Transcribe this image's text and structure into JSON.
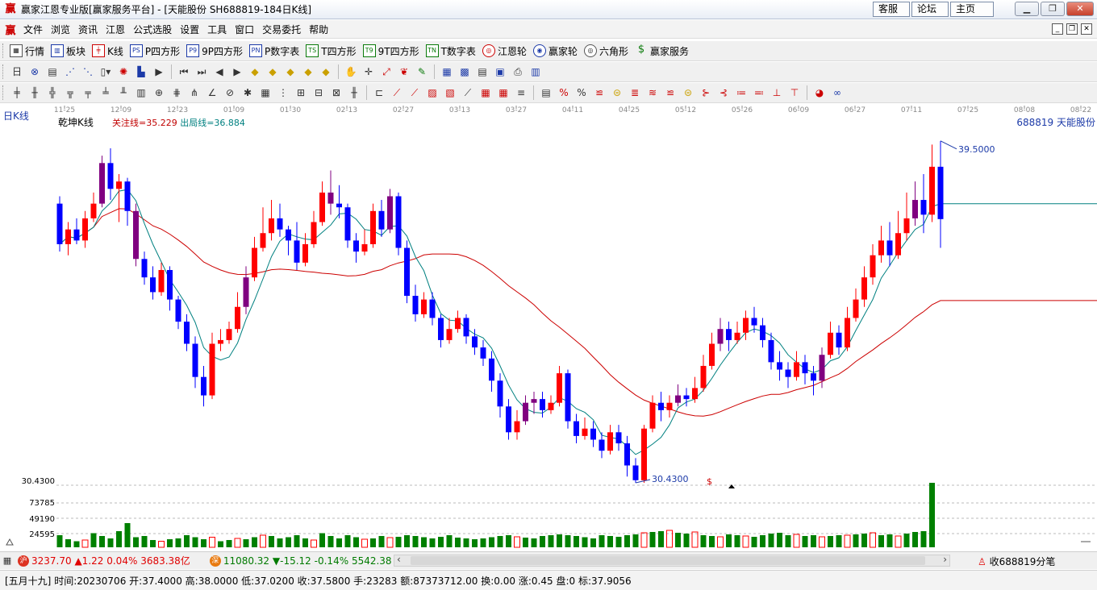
{
  "window": {
    "title": "赢家江恩专业版[赢家服务平台] - [天能股份  SH688819-184日K线]",
    "logo": "赢",
    "links": [
      "客服",
      "论坛",
      "主页"
    ]
  },
  "menu": [
    "文件",
    "浏览",
    "资讯",
    "江恩",
    "公式选股",
    "设置",
    "工具",
    "窗口",
    "交易委托",
    "帮助"
  ],
  "toolbar1": [
    {
      "icon": "grid-icon",
      "glyph": "▦",
      "label": "行情"
    },
    {
      "icon": "blocks-icon",
      "glyph": "▥",
      "label": "板块"
    },
    {
      "icon": "candle-icon",
      "glyph": "╪",
      "label": "K线"
    },
    {
      "icon": "ps-icon",
      "glyph": "PS",
      "label": "P四方形"
    },
    {
      "icon": "p9-icon",
      "glyph": "P9",
      "label": "9P四方形"
    },
    {
      "icon": "pn-icon",
      "glyph": "PN",
      "label": "P数字表"
    },
    {
      "icon": "ts-icon",
      "glyph": "TS",
      "label": "T四方形"
    },
    {
      "icon": "t9-icon",
      "glyph": "T9",
      "label": "9T四方形"
    },
    {
      "icon": "tn-icon",
      "glyph": "TN",
      "label": "T数字表"
    },
    {
      "icon": "gann-wheel-icon",
      "glyph": "◎",
      "label": "江恩轮"
    },
    {
      "icon": "winner-wheel-icon",
      "glyph": "◉",
      "label": "赢家轮"
    },
    {
      "icon": "hexagon-icon",
      "glyph": "◎",
      "label": "六角形"
    },
    {
      "icon": "dollar-icon",
      "glyph": "$",
      "label": "赢家服务"
    }
  ],
  "chart": {
    "period_label": "日K线",
    "indicator_name": "乾坤K线",
    "watch_line": "关注线=35.229",
    "exit_line": "出局线=36.884",
    "symbol_label": "688819  天能股份",
    "high_marker": "39.5000",
    "low_marker": "30.4300",
    "low_axis_label": "30.4300",
    "vol_levels": [
      "73785",
      "49190",
      "24595"
    ],
    "dollar_mark": "$",
    "date_ticks": [
      "11-25",
      "12-09",
      "12-23",
      "01-09",
      "01-30",
      "02-13",
      "02-27",
      "03-13",
      "03-27",
      "04-11",
      "04-25",
      "05-12",
      "05-26",
      "06-09",
      "06-27",
      "07-11",
      "07-25",
      "08-08",
      "08-22"
    ],
    "colors": {
      "up": "#ff0000",
      "down": "#0000ff",
      "neutral": "#800080",
      "slow_line": "#cc0000",
      "fast_line": "#008080",
      "volume": "#008000"
    }
  },
  "chart_data": {
    "type": "candlestick",
    "series": [
      {
        "name": "price",
        "values": [
          [
            38.0,
            36.9,
            38.2,
            36.7
          ],
          [
            36.9,
            37.3,
            37.5,
            36.6
          ],
          [
            37.3,
            37.0,
            37.6,
            36.9
          ],
          [
            37.0,
            37.6,
            37.8,
            36.8
          ],
          [
            37.6,
            38.0,
            38.3,
            37.5
          ],
          [
            38.0,
            39.1,
            39.3,
            37.9
          ],
          [
            39.1,
            38.4,
            39.5,
            38.1
          ],
          [
            38.4,
            38.6,
            38.8,
            37.5
          ],
          [
            38.6,
            37.8,
            38.7,
            37.4
          ],
          [
            37.8,
            36.5,
            38.0,
            36.3
          ],
          [
            36.5,
            36.0,
            36.7,
            35.8
          ],
          [
            36.0,
            35.6,
            36.3,
            35.4
          ],
          [
            35.6,
            36.2,
            36.4,
            35.5
          ],
          [
            36.2,
            35.4,
            36.3,
            35.1
          ],
          [
            35.4,
            34.8,
            35.5,
            34.6
          ],
          [
            34.8,
            34.2,
            35.0,
            34.0
          ],
          [
            34.2,
            33.3,
            34.4,
            33.0
          ],
          [
            33.3,
            32.8,
            33.6,
            32.5
          ],
          [
            32.8,
            34.2,
            34.5,
            32.7
          ],
          [
            34.2,
            34.3,
            34.6,
            34.0
          ],
          [
            34.3,
            34.6,
            34.8,
            34.2
          ],
          [
            34.6,
            35.2,
            35.6,
            34.5
          ],
          [
            35.2,
            36.0,
            36.3,
            35.0
          ],
          [
            36.0,
            36.8,
            37.1,
            35.9
          ],
          [
            36.8,
            37.2,
            37.9,
            36.7
          ],
          [
            37.2,
            37.6,
            38.1,
            37.0
          ],
          [
            37.6,
            37.3,
            38.0,
            37.1
          ],
          [
            37.3,
            37.0,
            37.4,
            36.6
          ],
          [
            37.0,
            36.4,
            37.5,
            36.2
          ],
          [
            36.4,
            36.9,
            37.2,
            36.3
          ],
          [
            36.9,
            37.5,
            37.8,
            36.8
          ],
          [
            37.5,
            38.3,
            38.6,
            37.4
          ],
          [
            38.3,
            38.0,
            38.9,
            37.7
          ],
          [
            38.0,
            37.9,
            38.5,
            37.6
          ],
          [
            37.9,
            37.0,
            38.0,
            36.8
          ],
          [
            37.0,
            36.7,
            37.2,
            36.4
          ],
          [
            36.7,
            36.9,
            37.3,
            36.6
          ],
          [
            36.9,
            37.8,
            38.0,
            36.8
          ],
          [
            37.8,
            37.3,
            38.1,
            37.1
          ],
          [
            37.3,
            38.2,
            38.4,
            37.2
          ],
          [
            38.2,
            36.8,
            38.3,
            36.6
          ],
          [
            36.8,
            35.5,
            37.0,
            35.3
          ],
          [
            35.5,
            35.0,
            35.8,
            34.8
          ],
          [
            35.0,
            35.4,
            35.6,
            34.9
          ],
          [
            35.4,
            34.9,
            35.6,
            34.7
          ],
          [
            34.9,
            34.3,
            35.0,
            34.1
          ],
          [
            34.3,
            34.6,
            34.9,
            34.2
          ],
          [
            34.6,
            34.9,
            35.1,
            34.5
          ],
          [
            34.9,
            34.4,
            35.0,
            34.2
          ],
          [
            34.4,
            34.1,
            34.6,
            33.9
          ],
          [
            34.1,
            33.8,
            34.3,
            33.6
          ],
          [
            33.8,
            33.2,
            34.0,
            32.9
          ],
          [
            33.2,
            32.5,
            33.4,
            32.2
          ],
          [
            32.5,
            31.8,
            32.7,
            31.6
          ],
          [
            31.8,
            32.1,
            32.4,
            31.6
          ],
          [
            32.1,
            32.6,
            32.8,
            32.0
          ],
          [
            32.6,
            32.7,
            32.9,
            32.3
          ],
          [
            32.7,
            32.4,
            32.9,
            32.2
          ],
          [
            32.4,
            32.6,
            32.8,
            32.3
          ],
          [
            32.6,
            33.4,
            33.6,
            32.5
          ],
          [
            33.4,
            32.1,
            33.5,
            31.9
          ],
          [
            32.1,
            31.7,
            32.3,
            31.5
          ],
          [
            31.7,
            31.9,
            32.2,
            31.6
          ],
          [
            31.9,
            31.6,
            32.1,
            31.4
          ],
          [
            31.6,
            31.3,
            31.8,
            31.1
          ],
          [
            31.3,
            31.8,
            32.0,
            31.2
          ],
          [
            31.8,
            31.5,
            32.0,
            31.3
          ],
          [
            31.5,
            30.9,
            31.7,
            30.6
          ],
          [
            30.9,
            30.5,
            31.1,
            30.43
          ],
          [
            30.5,
            31.9,
            32.0,
            30.43
          ],
          [
            31.9,
            32.6,
            32.8,
            31.8
          ],
          [
            32.6,
            32.4,
            32.9,
            32.1
          ],
          [
            32.4,
            32.6,
            32.8,
            32.2
          ],
          [
            32.6,
            32.8,
            33.1,
            32.5
          ],
          [
            32.8,
            32.7,
            33.0,
            32.5
          ],
          [
            32.7,
            33.0,
            33.3,
            32.6
          ],
          [
            33.0,
            33.6,
            33.9,
            32.9
          ],
          [
            33.6,
            34.2,
            34.5,
            33.5
          ],
          [
            34.2,
            34.6,
            34.9,
            34.0
          ],
          [
            34.6,
            34.3,
            34.8,
            34.0
          ],
          [
            34.3,
            34.5,
            34.8,
            34.2
          ],
          [
            34.5,
            34.9,
            35.1,
            34.3
          ],
          [
            34.9,
            34.7,
            35.2,
            34.5
          ],
          [
            34.7,
            34.3,
            34.9,
            34.1
          ],
          [
            34.3,
            33.7,
            34.5,
            33.5
          ],
          [
            33.7,
            33.5,
            34.0,
            33.2
          ],
          [
            33.5,
            33.3,
            33.7,
            33.0
          ],
          [
            33.3,
            33.7,
            34.0,
            33.2
          ],
          [
            33.7,
            33.4,
            33.9,
            33.1
          ],
          [
            33.4,
            33.2,
            33.6,
            32.8
          ],
          [
            33.2,
            33.9,
            34.1,
            33.0
          ],
          [
            33.9,
            34.5,
            34.8,
            33.8
          ],
          [
            34.5,
            34.1,
            34.7,
            33.9
          ],
          [
            34.1,
            34.9,
            35.2,
            34.0
          ],
          [
            34.9,
            35.4,
            35.7,
            34.8
          ],
          [
            35.4,
            36.0,
            36.3,
            35.2
          ],
          [
            36.0,
            36.6,
            36.9,
            35.8
          ],
          [
            36.6,
            37.0,
            37.4,
            36.4
          ],
          [
            37.0,
            36.6,
            37.5,
            36.3
          ],
          [
            36.6,
            37.2,
            37.8,
            36.5
          ],
          [
            37.2,
            37.6,
            38.3,
            37.0
          ],
          [
            37.6,
            38.1,
            38.6,
            37.4
          ],
          [
            38.1,
            37.7,
            38.8,
            37.2
          ],
          [
            37.7,
            39.0,
            39.6,
            37.5
          ],
          [
            39.0,
            37.58,
            39.7,
            36.8
          ]
        ]
      },
      {
        "name": "volume",
        "values": [
          30,
          20,
          15,
          18,
          35,
          28,
          22,
          40,
          60,
          25,
          28,
          18,
          15,
          20,
          22,
          30,
          25,
          20,
          25,
          15,
          18,
          22,
          20,
          25,
          30,
          28,
          22,
          25,
          30,
          22,
          18,
          35,
          28,
          22,
          30,
          25,
          20,
          22,
          28,
          24,
          26,
          30,
          28,
          25,
          22,
          26,
          30,
          24,
          22,
          20,
          22,
          25,
          28,
          30,
          26,
          24,
          22,
          28,
          30,
          32,
          30,
          28,
          25,
          22,
          30,
          28,
          26,
          30,
          32,
          36,
          38,
          40,
          42,
          36,
          34,
          38,
          30,
          28,
          26,
          32,
          30,
          28,
          26,
          30,
          34,
          36,
          30,
          32,
          28,
          30,
          26,
          28,
          30,
          30,
          32,
          34,
          36,
          30,
          32,
          28,
          34,
          38,
          40,
          160
        ]
      }
    ],
    "price_low": 30.43,
    "price_high": 39.5,
    "watch_line": 35.229,
    "exit_line": 36.884
  },
  "index_bar": {
    "sh_value": "3237.70",
    "sh_change": "▲1.22",
    "sh_pct": "0.04%",
    "sh_amount": "3683.38亿",
    "sz_value": "11080.32",
    "sz_change": "▼-15.12",
    "sz_pct": "-0.14%",
    "sz_amount": "5542.38",
    "collect_label": "收688819分笔"
  },
  "status": {
    "lunar": "[五月十九]",
    "time": "时间:20230706",
    "open": "开:37.4000",
    "high": "高:38.0000",
    "low": "低:37.0200",
    "close": "收:37.5800",
    "hands": "手:23283",
    "amount": "额:87373712.00",
    "turnover": "换:0.00",
    "rise": "涨:0.45",
    "disk": "盘:0",
    "mark": "标:37.9056"
  }
}
